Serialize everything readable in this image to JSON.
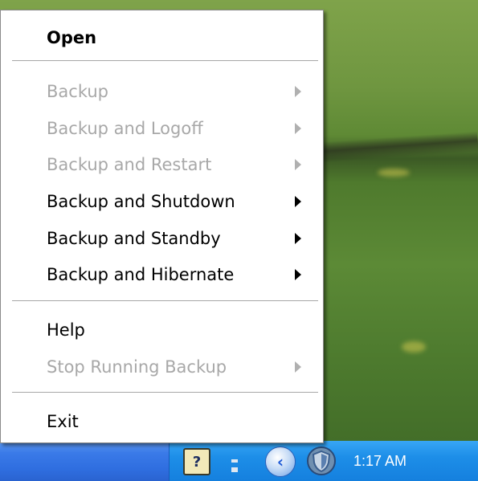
{
  "context_menu": {
    "items": [
      {
        "label": "Open",
        "enabled": true,
        "bold": true,
        "submenu": false
      },
      {
        "label": "Backup",
        "enabled": false,
        "submenu": true
      },
      {
        "label": "Backup and Logoff",
        "enabled": false,
        "submenu": true
      },
      {
        "label": "Backup and Restart",
        "enabled": false,
        "submenu": true
      },
      {
        "label": "Backup and Shutdown",
        "enabled": true,
        "submenu": true
      },
      {
        "label": "Backup and Standby",
        "enabled": true,
        "submenu": true
      },
      {
        "label": "Backup and Hibernate",
        "enabled": true,
        "submenu": true
      },
      {
        "label": "Help",
        "enabled": true,
        "submenu": false
      },
      {
        "label": "Stop Running Backup",
        "enabled": false,
        "submenu": true
      },
      {
        "label": "Exit",
        "enabled": true,
        "submenu": false
      }
    ]
  },
  "taskbar": {
    "tray_icons": [
      "help-icon",
      "usb-device-icon",
      "show-hidden-icons-chevron",
      "security-shield-icon"
    ],
    "clock": "1:17 AM"
  },
  "colors": {
    "menu_background": "#ffffff",
    "disabled_text": "#a8a8a8",
    "taskbar_blue": "#2f6ee0",
    "tray_blue": "#1d8ee8"
  }
}
